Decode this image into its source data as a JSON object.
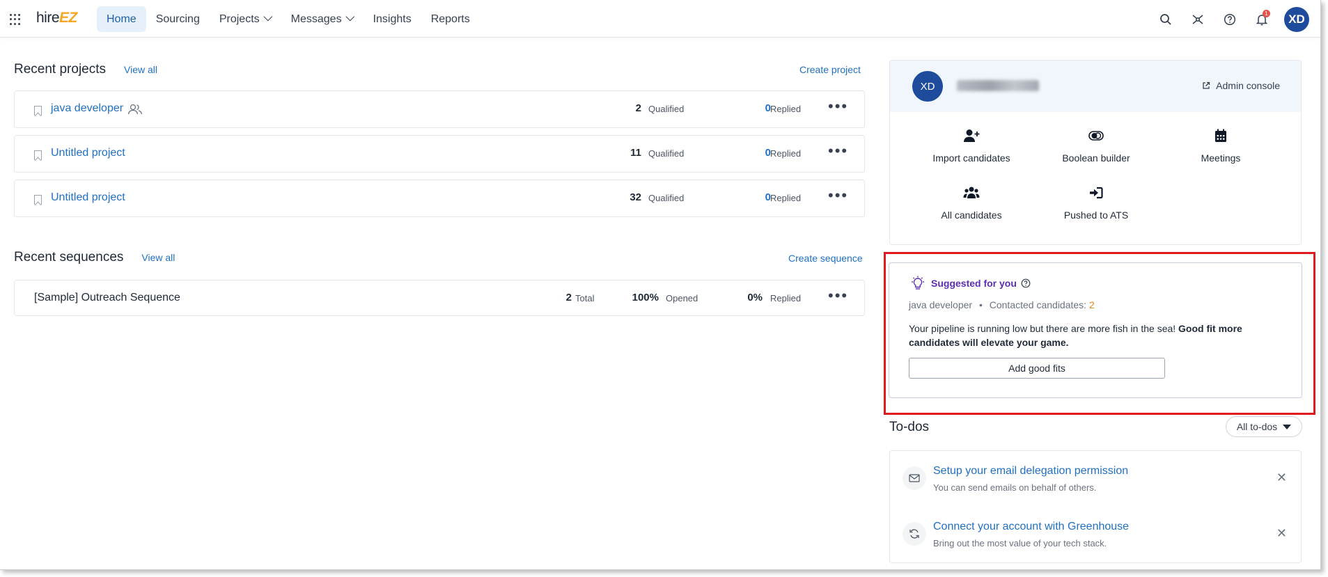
{
  "nav": {
    "logo_prefix": "hire",
    "logo_suffix": "EZ",
    "items": [
      {
        "label": "Home",
        "active": true
      },
      {
        "label": "Sourcing"
      },
      {
        "label": "Projects",
        "dropdown": true
      },
      {
        "label": "Messages",
        "dropdown": true
      },
      {
        "label": "Insights"
      },
      {
        "label": "Reports"
      }
    ],
    "notification_count": "1",
    "user_initials": "XD"
  },
  "projects": {
    "title": "Recent projects",
    "view_all": "View all",
    "create": "Create project",
    "rows": [
      {
        "name": "java developer",
        "qualified": "2",
        "qualified_label": "Qualified",
        "replied": "0",
        "replied_label": "Replied"
      },
      {
        "name": "Untitled project",
        "qualified": "11",
        "qualified_label": "Qualified",
        "replied": "0",
        "replied_label": "Replied"
      },
      {
        "name": "Untitled project",
        "qualified": "32",
        "qualified_label": "Qualified",
        "replied": "0",
        "replied_label": "Replied"
      }
    ]
  },
  "sequences": {
    "title": "Recent sequences",
    "view_all": "View all",
    "create": "Create sequence",
    "rows": [
      {
        "name": "[Sample] Outreach Sequence",
        "total": "2",
        "total_label": "Total",
        "opened": "100%",
        "opened_label": "Opened",
        "replied": "0%",
        "replied_label": "Replied"
      }
    ]
  },
  "profile": {
    "initials": "XD",
    "admin_console": "Admin console",
    "quick_actions": [
      {
        "label": "Import candidates",
        "icon": "user-plus-icon"
      },
      {
        "label": "Boolean builder",
        "icon": "boolean-icon"
      },
      {
        "label": "Meetings",
        "icon": "calendar-icon"
      },
      {
        "label": "All candidates",
        "icon": "users-icon"
      },
      {
        "label": "Pushed to ATS",
        "icon": "sign-in-icon"
      }
    ]
  },
  "suggest": {
    "title": "Suggested for you",
    "project": "java developer",
    "contacted_label": "Contacted candidates:",
    "contacted_count": "2",
    "text_plain": "Your pipeline is running low but there are more fish in the sea!",
    "text_bold": "Good fit more candidates will elevate your game.",
    "button": "Add good fits"
  },
  "todos": {
    "title": "To-dos",
    "filter": "All to-dos",
    "items": [
      {
        "title": "Setup your email delegation permission",
        "sub": "You can send emails on behalf of others.",
        "icon": "mail-icon"
      },
      {
        "title": "Connect your account with Greenhouse",
        "sub": "Bring out the most value of your tech stack.",
        "icon": "sync-icon"
      }
    ]
  },
  "colors": {
    "accent": "#1f6fc4",
    "brand_avatar": "#1e4b9c",
    "highlight": "#e0191e",
    "suggest_purple": "#5b2db5"
  }
}
